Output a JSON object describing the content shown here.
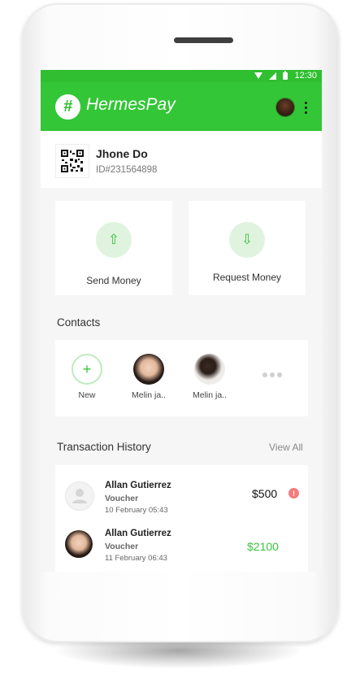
{
  "status": {
    "time": "12:30"
  },
  "app": {
    "title": "HermesPay",
    "logo_glyph": "#"
  },
  "profile": {
    "name": "Jhone Do",
    "id": "ID#231564898"
  },
  "actions": [
    {
      "label": "Send Money",
      "icon": "arrow-up-icon",
      "glyph": "⇧"
    },
    {
      "label": "Request Money",
      "icon": "arrow-down-icon",
      "glyph": "⇩"
    }
  ],
  "contacts": {
    "title": "Contacts",
    "new_label": "New",
    "new_glyph": "+",
    "items": [
      {
        "label": "Melin ja.."
      },
      {
        "label": "Melin ja.."
      }
    ]
  },
  "history": {
    "title": "Transaction History",
    "view_all": "View All",
    "items": [
      {
        "name": "Allan Gutierrez",
        "type": "Voucher",
        "date": "10 February 05:43",
        "amount": "$500",
        "amount_color": "#111111",
        "alert": "!"
      },
      {
        "name": "Allan Gutierrez",
        "type": "Voucher",
        "date": "11 February 06:43",
        "amount": "$2100",
        "amount_color": "#39c43c"
      }
    ]
  },
  "colors": {
    "brand": "#33c636",
    "accent_light": "#dff3df",
    "alert": "#f47c7c"
  }
}
